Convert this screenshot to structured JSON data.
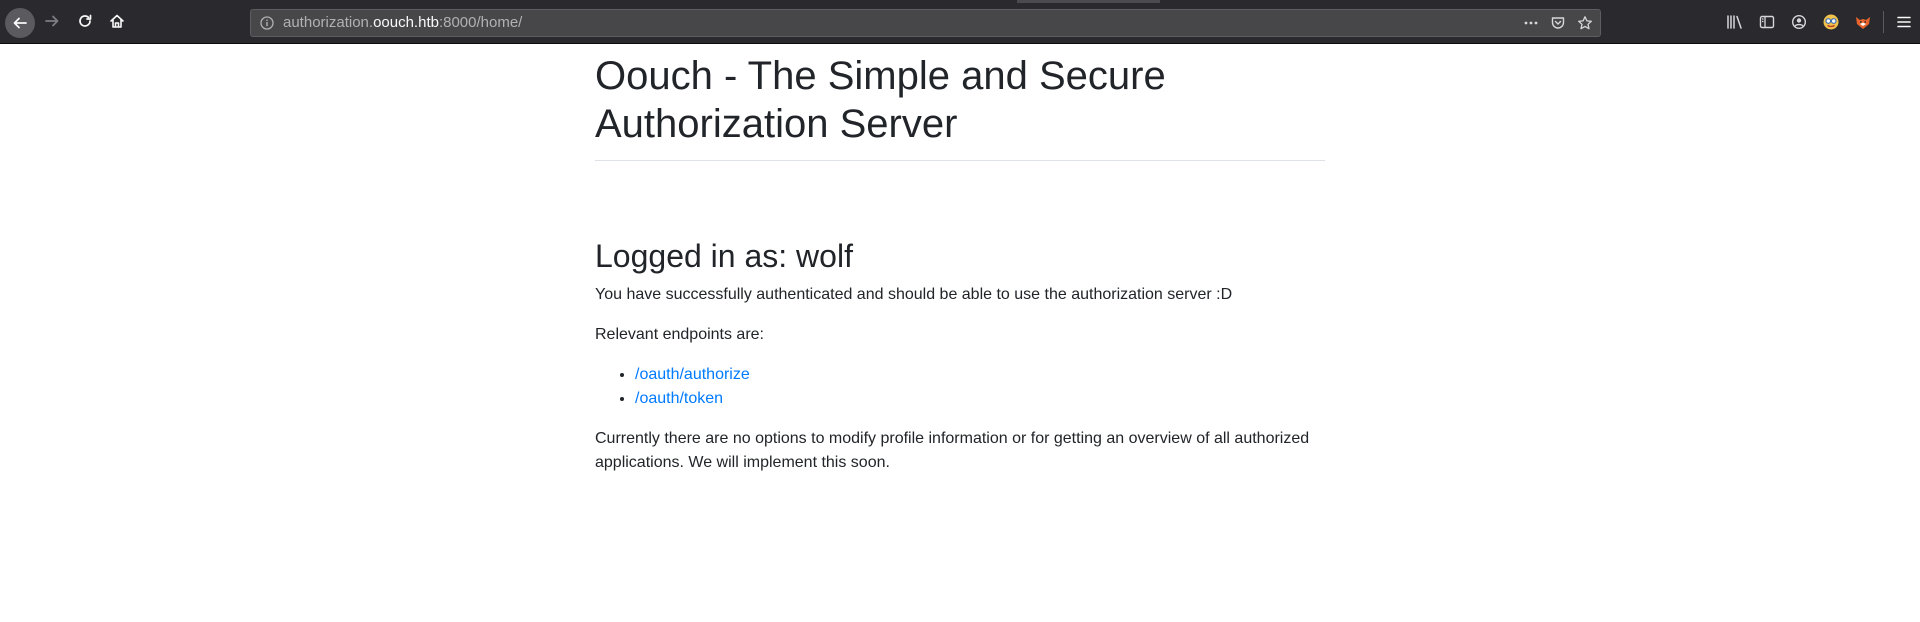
{
  "browser": {
    "url_prefix": "authorization.",
    "url_host": "oouch.htb",
    "url_suffix": ":8000/home/"
  },
  "icons": {
    "back": "back-arrow-icon",
    "forward": "forward-arrow-icon",
    "reload": "reload-icon",
    "home": "home-icon",
    "site_info": "info-icon",
    "page_actions": "more-dots-icon",
    "pocket": "pocket-icon",
    "bookmark": "star-icon",
    "library": "library-icon",
    "sidebar": "sidebar-icon",
    "account": "account-icon",
    "extension1": "extension-icon",
    "extension2": "fox-extension-icon",
    "menu": "hamburger-menu-icon"
  },
  "page": {
    "title": "Oouch - The Simple and Secure Authorization Server",
    "logged_in_heading": "Logged in as: wolf",
    "success_text": "You have successfully authenticated and should be able to use the authorization server :D",
    "endpoints_intro": "Relevant endpoints are:",
    "endpoints": [
      {
        "label": "/oauth/authorize"
      },
      {
        "label": "/oauth/token"
      }
    ],
    "notice_text": "Currently there are no options to modify profile information or for getting an overview of all authorized applications. We will implement this soon."
  },
  "colors": {
    "chrome_bg": "#2a2a2e",
    "urlbar_bg": "#474749",
    "text": "#212529",
    "link": "#007bff"
  }
}
